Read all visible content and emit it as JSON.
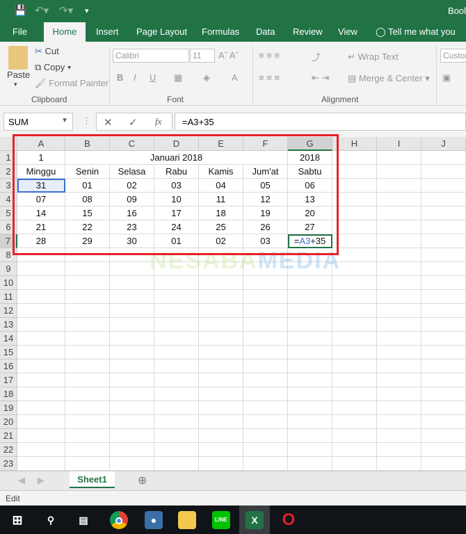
{
  "title_bar": {
    "doc_title": "Bool"
  },
  "ribbon_tabs": [
    "File",
    "Home",
    "Insert",
    "Page Layout",
    "Formulas",
    "Data",
    "Review",
    "View",
    "Tell me what you war"
  ],
  "clipboard": {
    "paste": "Paste",
    "cut": "Cut",
    "copy": "Copy",
    "format_painter": "Format Painter",
    "group": "Clipboard"
  },
  "font": {
    "name": "Calibri",
    "size": "11",
    "group": "Font",
    "bold": "B",
    "italic": "I",
    "underline": "U"
  },
  "alignment": {
    "wrap": "Wrap Text",
    "merge": "Merge & Center",
    "group": "Alignment"
  },
  "number": {
    "format": "Custon"
  },
  "formula_bar": {
    "name_box": "SUM",
    "formula": "=A3+35",
    "fx": "fx"
  },
  "columns": [
    "A",
    "B",
    "C",
    "D",
    "E",
    "F",
    "G",
    "H",
    "I",
    "J"
  ],
  "rows": [
    "1",
    "2",
    "3",
    "4",
    "5",
    "6",
    "7",
    "8",
    "9",
    "10",
    "11",
    "12",
    "13",
    "14",
    "15",
    "16",
    "17",
    "18",
    "19",
    "20",
    "21",
    "22",
    "23"
  ],
  "cells": {
    "r1": {
      "a": "1",
      "merged": "Januari 2018",
      "g": "2018"
    },
    "r2": [
      "Minggu",
      "Senin",
      "Selasa",
      "Rabu",
      "Kamis",
      "Jum'at",
      "Sabtu"
    ],
    "r3": [
      "31",
      "01",
      "02",
      "03",
      "04",
      "05",
      "06"
    ],
    "r4": [
      "07",
      "08",
      "09",
      "10",
      "11",
      "12",
      "13"
    ],
    "r5": [
      "14",
      "15",
      "16",
      "17",
      "18",
      "19",
      "20"
    ],
    "r6": [
      "21",
      "22",
      "23",
      "24",
      "25",
      "26",
      "27"
    ],
    "r7": [
      "28",
      "29",
      "30",
      "01",
      "02",
      "03"
    ],
    "g7_formula": {
      "eq": "=",
      "ref": "A3",
      "rest": "+35"
    }
  },
  "watermark": {
    "a": "NESABA",
    "b": "MEDIA"
  },
  "sheet_tabs": [
    "Sheet1"
  ],
  "status": "Edit",
  "colors": {
    "excel_green": "#217346",
    "highlight_red": "#e8202a",
    "ref_blue": "#3b6fd6"
  },
  "taskbar": [
    "windows-start",
    "search",
    "task-view",
    "chrome",
    "app",
    "file-explorer",
    "line",
    "excel",
    "opera"
  ]
}
